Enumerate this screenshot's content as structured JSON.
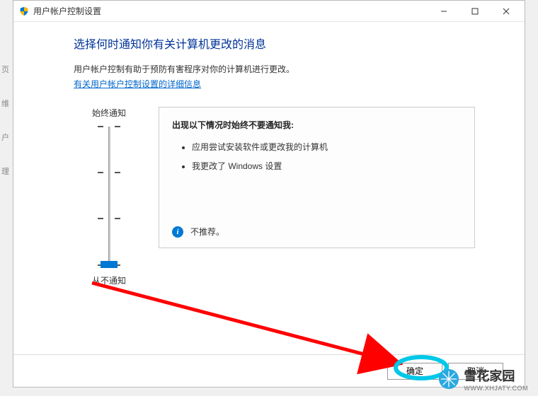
{
  "window": {
    "title": "用户帐户控制设置"
  },
  "content": {
    "heading": "选择何时通知你有关计算机更改的消息",
    "desc": "用户帐户控制有助于预防有害程序对你的计算机进行更改。",
    "link": "有关用户帐户控制设置的详细信息"
  },
  "slider": {
    "top_label": "始终通知",
    "bottom_label": "从不通知"
  },
  "infobox": {
    "title": "出现以下情况时始终不要通知我:",
    "bullet1": "应用尝试安装软件或更改我的计算机",
    "bullet2": "我更改了 Windows 设置",
    "footer": "不推荐。"
  },
  "buttons": {
    "ok": "确定",
    "cancel": "取消"
  },
  "watermark": {
    "name": "雪花家园",
    "url": "WWW.XHJATY.COM"
  },
  "sidebits": {
    "a": "页",
    "b": "维",
    "c": "户",
    "d": "理"
  }
}
